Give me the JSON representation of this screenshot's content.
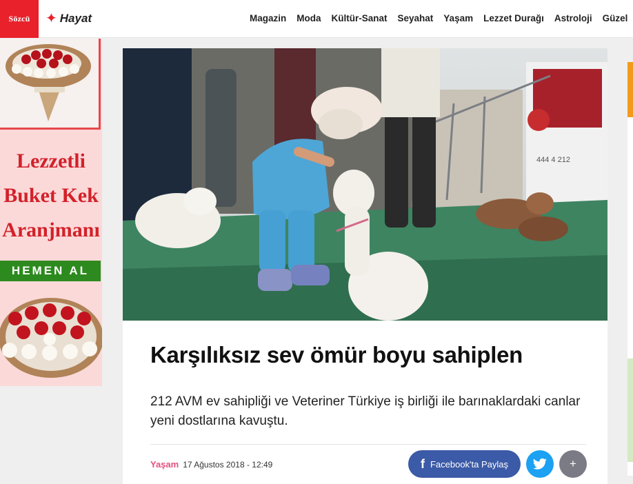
{
  "header": {
    "logo": "Sözcü",
    "section": "Hayat",
    "nav": [
      "Magazin",
      "Moda",
      "Kültür-Sanat",
      "Seyahat",
      "Yaşam",
      "Lezzet Durağı",
      "Astroloji",
      "Güzel"
    ]
  },
  "ad": {
    "lines": [
      "Lezzetli",
      "Buket Kek",
      "Aranjmanı"
    ],
    "cta": "HEMEN AL",
    "colors": {
      "text": "#d3212a",
      "button": "#2d8a1e",
      "background": "#fbd9d9"
    }
  },
  "article": {
    "title": "Karşılıksız sev ömür boyu sahiplen",
    "summary": "212 AVM ev sahipliği ve Veteriner Türkiye iş birliği ile barınaklardaki canlar yeni dostlarına kavuştu.",
    "category": "Yaşam",
    "date": "17 Ağustos 2018 - 12:49",
    "photo_sign": "444 4 212"
  },
  "share": {
    "facebook_label": "Facebook'ta Paylaş",
    "twitter_icon": "twitter-bird-icon",
    "more_label": "+"
  },
  "colors": {
    "brand": "#e8212b",
    "category": "#e2517b",
    "facebook": "#3b5aa7",
    "twitter": "#1da1f2"
  }
}
